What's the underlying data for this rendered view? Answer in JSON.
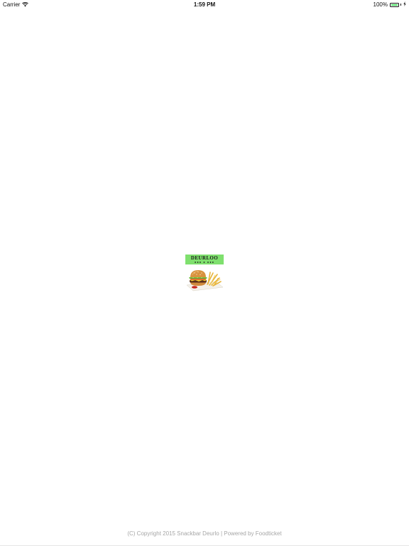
{
  "status_bar": {
    "carrier": "Carrier",
    "time": "1:59 PM",
    "battery_percent": "100%",
    "battery_level": 1.0,
    "icons": [
      "wifi-icon",
      "battery-icon",
      "charging-icon"
    ],
    "battery_color": "#4cd964"
  },
  "splash": {
    "logo_name": "DEURLOO",
    "logo_banner_color": "#7fe06e",
    "logo_image_icon": "burger-fries-image"
  },
  "footer": {
    "copyright": "(C) Copyright 2015 Snackbar Deurlo | Powered by Foodticket"
  }
}
